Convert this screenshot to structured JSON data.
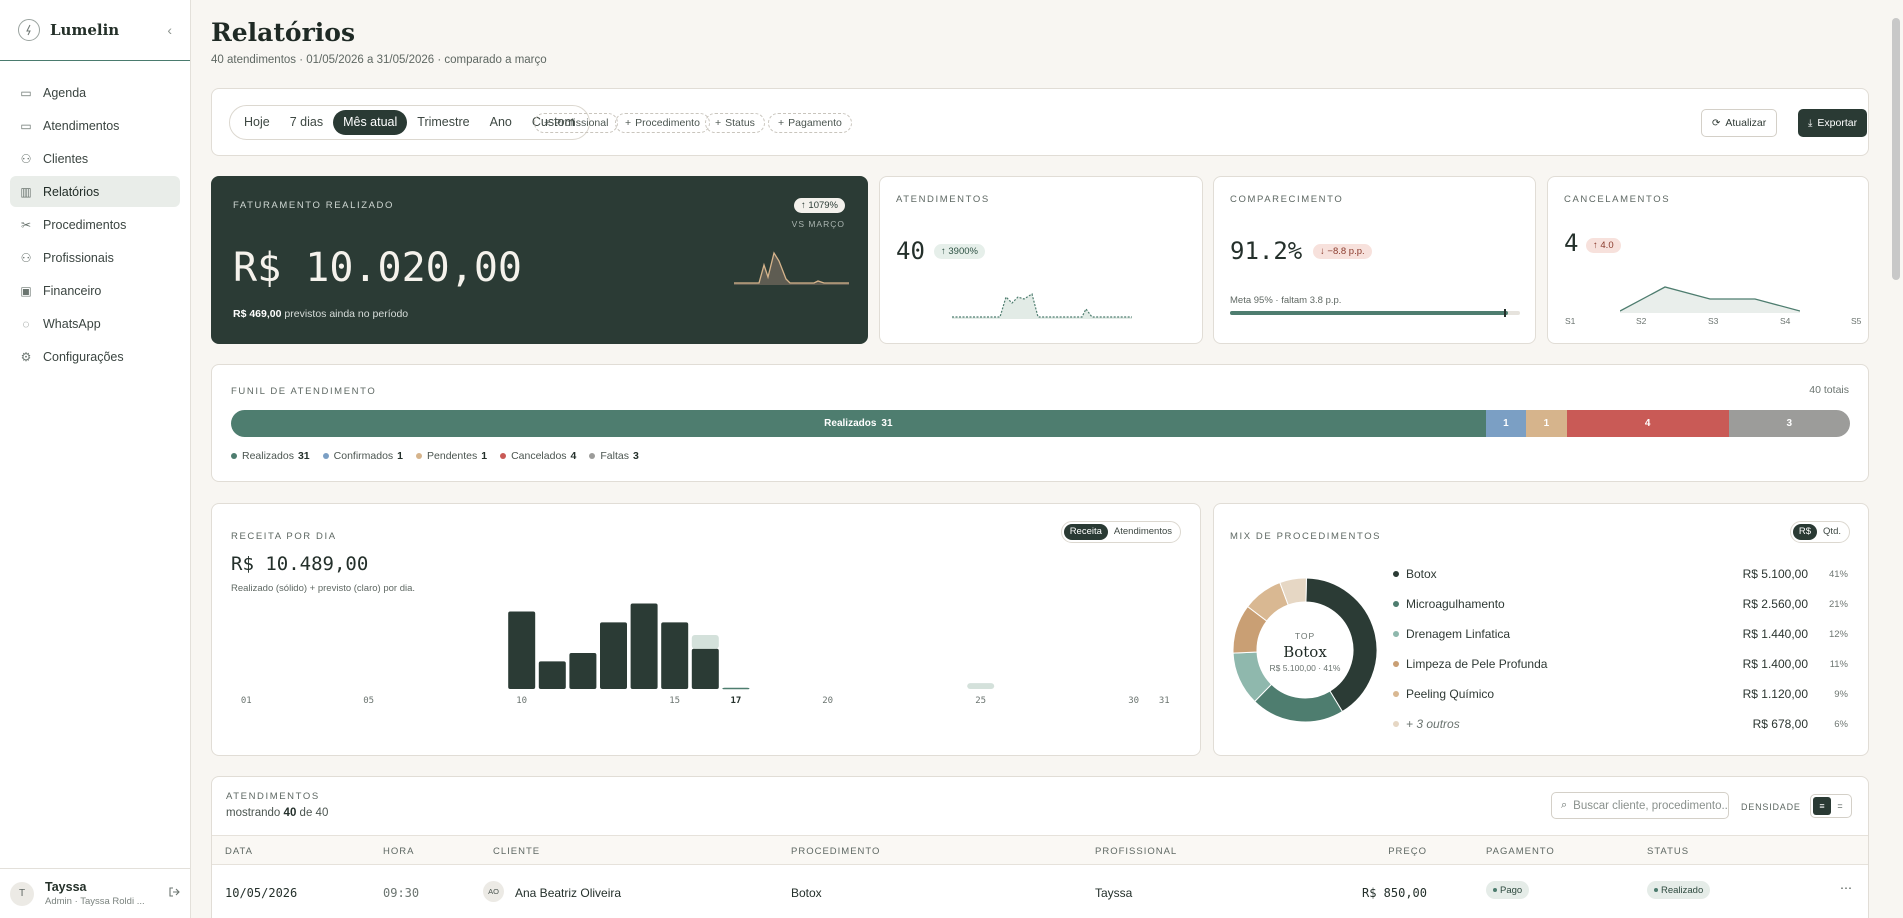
{
  "app": {
    "name": "Lumelin",
    "collapse_glyph": "‹"
  },
  "sidebar": {
    "items": [
      {
        "label": "Agenda",
        "icon": "calendar-icon"
      },
      {
        "label": "Atendimentos",
        "icon": "calendar-check-icon"
      },
      {
        "label": "Clientes",
        "icon": "users-icon"
      },
      {
        "label": "Relatórios",
        "icon": "bar-chart-icon",
        "active": true
      },
      {
        "label": "Procedimentos",
        "icon": "scissors-icon"
      },
      {
        "label": "Profissionais",
        "icon": "user-cog-icon"
      },
      {
        "label": "Financeiro",
        "icon": "wallet-icon"
      },
      {
        "label": "WhatsApp",
        "icon": "message-icon"
      },
      {
        "label": "Configurações",
        "icon": "gear-icon"
      }
    ],
    "user": {
      "initial": "T",
      "name": "Tayssa",
      "role": "Admin · Tayssa Roldi ..."
    }
  },
  "page": {
    "title": "Relatórios",
    "subtitle": "40 atendimentos · 01/05/2026 a 31/05/2026 · comparado a março"
  },
  "filters": {
    "periods": [
      "Hoje",
      "7 dias",
      "Mês atual",
      "Trimestre",
      "Ano",
      "Custom"
    ],
    "active_period": "Mês atual",
    "chips": [
      "Profissional",
      "Procedimento",
      "Status",
      "Pagamento"
    ],
    "refresh_label": "Atualizar",
    "export_label": "Exportar"
  },
  "kpis": {
    "revenue": {
      "label": "FATURAMENTO REALIZADO",
      "value": "R$ 10.020,00",
      "delta": "1079%",
      "vs": "VS MARÇO",
      "note_value": "R$ 469,00",
      "note_text": "previstos ainda no período"
    },
    "appointments": {
      "label": "ATENDIMENTOS",
      "value": "40",
      "delta": "3900%"
    },
    "attendance": {
      "label": "COMPARECIMENTO",
      "value": "91.2%",
      "delta": "−8.8 p.p.",
      "goal_text": "Meta 95% · faltam 3.8 p.p.",
      "progress": 0.96
    },
    "cancellations": {
      "label": "CANCELAMENTOS",
      "value": "4",
      "delta": "4.0",
      "weeks": [
        "S1",
        "S2",
        "S3",
        "S4",
        "S5"
      ]
    }
  },
  "funnel": {
    "title": "FUNIL DE ATENDIMENTO",
    "total": "40 totais",
    "segments": [
      {
        "label": "Realizados",
        "value": 31,
        "color": "#4e7d6f"
      },
      {
        "label": "Confirmados",
        "value": 1,
        "color": "#7b9fc4"
      },
      {
        "label": "Pendentes",
        "value": 1,
        "color": "#d6b48c"
      },
      {
        "label": "Cancelados",
        "value": 4,
        "color": "#c95a56"
      },
      {
        "label": "Faltas",
        "value": 3,
        "color": "#9c9c9a"
      }
    ]
  },
  "revenue_chart": {
    "title": "RECEITA POR DIA",
    "value": "R$ 10.489,00",
    "caption": "Realizado (sólido) + previsto (claro) por dia.",
    "toggle": [
      "Receita",
      "Atendimentos"
    ],
    "toggle_active": "Receita",
    "x_labels": [
      "01",
      "05",
      "10",
      "15",
      "17",
      "20",
      "25",
      "30",
      "31"
    ]
  },
  "chart_data": {
    "type": "bar",
    "categories": [
      "1",
      "2",
      "3",
      "4",
      "5",
      "6",
      "7",
      "8",
      "9",
      "10",
      "11",
      "12",
      "13",
      "14",
      "15",
      "16",
      "17",
      "18",
      "19",
      "20",
      "21",
      "22",
      "23",
      "24",
      "25",
      "26",
      "27",
      "28",
      "29",
      "30",
      "31"
    ],
    "series": [
      {
        "name": "Realizado",
        "values": [
          0,
          0,
          0,
          0,
          0,
          0,
          0,
          0,
          0,
          1850,
          660,
          860,
          1590,
          2040,
          1590,
          960,
          30,
          0,
          0,
          0,
          0,
          0,
          0,
          0,
          0,
          0,
          0,
          0,
          0,
          0,
          0
        ]
      },
      {
        "name": "Previsto",
        "values": [
          0,
          0,
          0,
          0,
          0,
          0,
          0,
          0,
          0,
          0,
          0,
          0,
          0,
          0,
          0,
          330,
          0,
          0,
          0,
          0,
          0,
          0,
          0,
          0,
          139,
          0,
          0,
          0,
          0,
          0,
          0
        ]
      }
    ],
    "title": "RECEITA POR DIA",
    "xlabel": "",
    "ylabel": "",
    "ylim": [
      0,
      2100
    ]
  },
  "mix": {
    "title": "MIX DE PROCEDIMENTOS",
    "toggle": [
      "R$",
      "Qtd."
    ],
    "toggle_active": "R$",
    "center_label": "TOP",
    "center_name": "Botox",
    "center_sub": "R$ 5.100,00 · 41%",
    "items": [
      {
        "name": "Botox",
        "value": "R$ 5.100,00",
        "pct": "41%",
        "share": 41,
        "color": "#2b3b35"
      },
      {
        "name": "Microagulhamento",
        "value": "R$ 2.560,00",
        "pct": "21%",
        "share": 21,
        "color": "#4e7d6f"
      },
      {
        "name": "Drenagem Linfatica",
        "value": "R$ 1.440,00",
        "pct": "12%",
        "share": 12,
        "color": "#8fb8ad"
      },
      {
        "name": "Limpeza de Pele Profunda",
        "value": "R$ 1.400,00",
        "pct": "11%",
        "share": 11,
        "color": "#c99f74"
      },
      {
        "name": "Peeling Químico",
        "value": "R$ 1.120,00",
        "pct": "9%",
        "share": 9,
        "color": "#d9b892"
      },
      {
        "name": "+ 3 outros",
        "value": "R$ 678,00",
        "pct": "6%",
        "share": 6,
        "color": "#e6d7c4"
      }
    ]
  },
  "table": {
    "title": "ATENDIMENTOS",
    "showing_prefix": "mostrando",
    "showing_count": "40",
    "showing_mid": "de",
    "showing_total": "40",
    "search_placeholder": "Buscar cliente, procedimento...",
    "density_label": "DENSIDADE",
    "columns": [
      "DATA",
      "HORA",
      "CLIENTE",
      "PROCEDIMENTO",
      "PROFISSIONAL",
      "PREÇO",
      "PAGAMENTO",
      "STATUS"
    ],
    "rows": [
      {
        "date": "10/05/2026",
        "time": "09:30",
        "initials": "AO",
        "client": "Ana Beatriz Oliveira",
        "procedure": "Botox",
        "professional": "Tayssa",
        "price": "R$ 850,00",
        "payment": "Pago",
        "status": "Realizado"
      }
    ]
  }
}
